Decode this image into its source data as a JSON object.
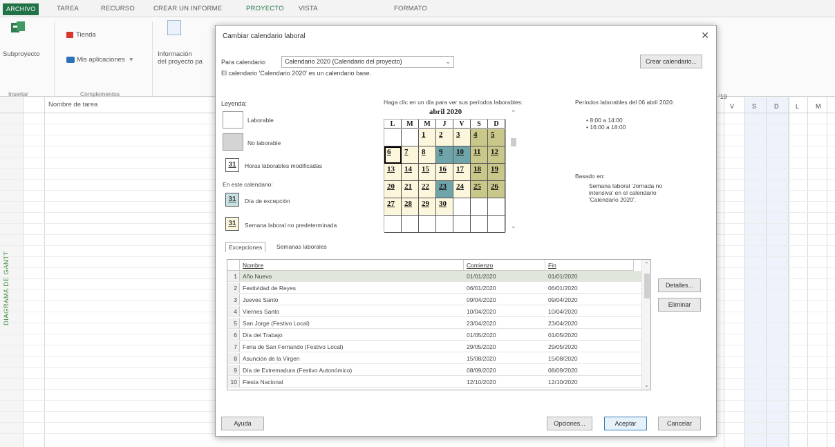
{
  "ribbon_tabs": [
    "ARCHIVO",
    "TAREA",
    "RECURSO",
    "CREAR UN INFORME",
    "PROYECTO",
    "VISTA",
    "FORMATO"
  ],
  "ribbon": {
    "subproyecto": "Subproyecto",
    "insertar": "Insertar",
    "tienda": "Tienda",
    "mis_aplicaciones": "Mis aplicaciones",
    "complementos": "Complementos",
    "informacion_1": "Información",
    "informacion_2": "del proyecto pa"
  },
  "grid": {
    "nombre_tarea_header": "Nombre de tarea",
    "gantt_label": "DIAGRAMA DE GANTT",
    "date_fragment": "'19",
    "day_headers": [
      "V",
      "S",
      "D",
      "L",
      "M"
    ]
  },
  "dialog": {
    "title": "Cambiar calendario laboral",
    "para_calendario_label": "Para calendario:",
    "calendar_select": "Calendario 2020 (Calendario del proyecto)",
    "base_note": "El calendario 'Calendario 2020' es un calendario base.",
    "crear_calendario": "Crear calendario...",
    "leyenda": "Leyenda:",
    "legend": {
      "laborable": "Laborable",
      "no_laborable": "No laborable",
      "horas_modificadas": "Horas laborables modificadas",
      "en_este_calendario": "En este calendario:",
      "dia_excepcion": "Día de excepción",
      "semana_no_pred": "Semana laboral no predeterminada",
      "day_sample": "31"
    },
    "haga_clic": "Haga clic en un día para ver sus períodos laborables:",
    "periodos_title": "Períodos laborables del 06 abril 2020:",
    "periodos": [
      "• 8:00 a 14:00",
      "• 16:00 a 18:00"
    ],
    "basado_en": "Basado en:",
    "basado_texto": [
      "Semana laboral 'Jornada no",
      "intensiva' en el calendario",
      "'Calendario 2020'."
    ],
    "subtabs": [
      "Excepciones",
      "Semanas laborales"
    ],
    "table_headers": {
      "nombre": "Nombre",
      "comienzo": "Comienzo",
      "fin": "Fin"
    },
    "exceptions": [
      {
        "n": "1",
        "nombre": "Año Nuevo",
        "comienzo": "01/01/2020",
        "fin": "01/01/2020"
      },
      {
        "n": "2",
        "nombre": "Festividad de Reyes",
        "comienzo": "06/01/2020",
        "fin": "06/01/2020"
      },
      {
        "n": "3",
        "nombre": "Jueves Santo",
        "comienzo": "09/04/2020",
        "fin": "09/04/2020"
      },
      {
        "n": "4",
        "nombre": "Viernes Santo",
        "comienzo": "10/04/2020",
        "fin": "10/04/2020"
      },
      {
        "n": "5",
        "nombre": "San Jorge (Festivo Local)",
        "comienzo": "23/04/2020",
        "fin": "23/04/2020"
      },
      {
        "n": "6",
        "nombre": "Día del Trabajo",
        "comienzo": "01/05/2020",
        "fin": "01/05/2020"
      },
      {
        "n": "7",
        "nombre": "Feria de San Fernando (Festivo Local)",
        "comienzo": "29/05/2020",
        "fin": "29/05/2020"
      },
      {
        "n": "8",
        "nombre": "Asunción de la Virgen",
        "comienzo": "15/08/2020",
        "fin": "15/08/2020"
      },
      {
        "n": "9",
        "nombre": "Día de Extremadura (Festivo Autonómico)",
        "comienzo": "08/09/2020",
        "fin": "08/09/2020"
      },
      {
        "n": "10",
        "nombre": "Fiesta Nacional",
        "comienzo": "12/10/2020",
        "fin": "12/10/2020"
      }
    ],
    "detalles": "Detalles...",
    "eliminar": "Eliminar",
    "ayuda": "Ayuda",
    "opciones": "Opciones...",
    "aceptar": "Aceptar",
    "cancelar": "Cancelar",
    "calendar": {
      "month": "abril 2020",
      "headers": [
        "L",
        "M",
        "M",
        "J",
        "V",
        "S",
        "D"
      ],
      "weeks": [
        [
          {
            "d": "",
            "s": "empty"
          },
          {
            "d": "",
            "s": "empty"
          },
          {
            "d": "1",
            "s": "work"
          },
          {
            "d": "2",
            "s": "work"
          },
          {
            "d": "3",
            "s": "work"
          },
          {
            "d": "4",
            "s": "week"
          },
          {
            "d": "5",
            "s": "week"
          }
        ],
        [
          {
            "d": "6",
            "s": "sel"
          },
          {
            "d": "7",
            "s": "work"
          },
          {
            "d": "8",
            "s": "work"
          },
          {
            "d": "9",
            "s": "exc"
          },
          {
            "d": "10",
            "s": "exc"
          },
          {
            "d": "11",
            "s": "week"
          },
          {
            "d": "12",
            "s": "week"
          }
        ],
        [
          {
            "d": "13",
            "s": "work"
          },
          {
            "d": "14",
            "s": "work"
          },
          {
            "d": "15",
            "s": "work"
          },
          {
            "d": "16",
            "s": "work"
          },
          {
            "d": "17",
            "s": "work"
          },
          {
            "d": "18",
            "s": "week"
          },
          {
            "d": "19",
            "s": "week"
          }
        ],
        [
          {
            "d": "20",
            "s": "work"
          },
          {
            "d": "21",
            "s": "work"
          },
          {
            "d": "22",
            "s": "work"
          },
          {
            "d": "23",
            "s": "exc"
          },
          {
            "d": "24",
            "s": "work"
          },
          {
            "d": "25",
            "s": "week"
          },
          {
            "d": "26",
            "s": "week"
          }
        ],
        [
          {
            "d": "27",
            "s": "work"
          },
          {
            "d": "28",
            "s": "work"
          },
          {
            "d": "29",
            "s": "work"
          },
          {
            "d": "30",
            "s": "work"
          },
          {
            "d": "",
            "s": "empty"
          },
          {
            "d": "",
            "s": "empty"
          },
          {
            "d": "",
            "s": "empty"
          }
        ],
        [
          {
            "d": "",
            "s": "empty"
          },
          {
            "d": "",
            "s": "empty"
          },
          {
            "d": "",
            "s": "empty"
          },
          {
            "d": "",
            "s": "empty"
          },
          {
            "d": "",
            "s": "empty"
          },
          {
            "d": "",
            "s": "empty"
          },
          {
            "d": "",
            "s": "empty"
          }
        ]
      ]
    }
  },
  "colors": {
    "accent": "#217346",
    "workday": "#fbf6dc",
    "weekend": "#c9c78a",
    "exception": "#6fa4aa",
    "nonwork": "#d4d4d4"
  }
}
